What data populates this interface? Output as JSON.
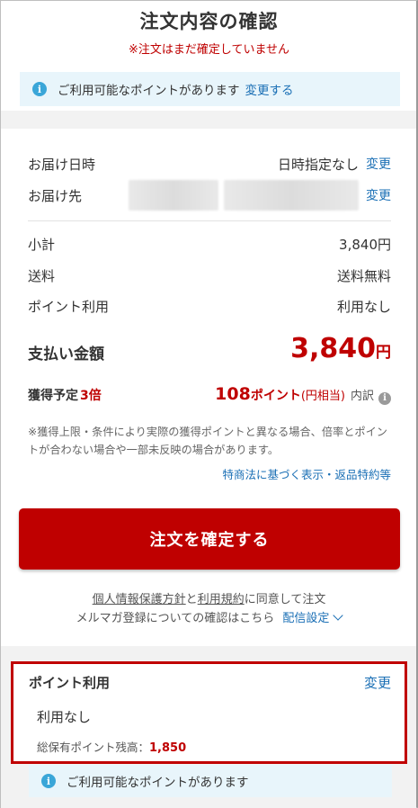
{
  "header": {
    "title": "注文内容の確認",
    "warning": "※注文はまだ確定していません"
  },
  "points_notice_top": {
    "text": "ご利用可能なポイントがあります",
    "link": "変更する",
    "icon": "info-icon"
  },
  "delivery": {
    "date_label": "お届け日時",
    "date_value": "日時指定なし",
    "date_change": "変更",
    "address_label": "お届け先",
    "address_change": "変更"
  },
  "summary": {
    "subtotal_label": "小計",
    "subtotal_value": "3,840円",
    "shipping_label": "送料",
    "shipping_value": "送料無料",
    "points_label": "ポイント利用",
    "points_value": "利用なし"
  },
  "total": {
    "label": "支払い金額",
    "amount": "3,840",
    "unit": "円"
  },
  "earned": {
    "label": "獲得予定",
    "multiplier": "3倍",
    "points": "108",
    "unit": "ポイント",
    "note": "(円相当)",
    "breakdown": "内訳",
    "help_icon": "info-circle-icon"
  },
  "disclaimer": "※獲得上限・条件により実際の獲得ポイントと異なる場合、倍率とポイントが合わない場合や一部未反映の場合があります。",
  "legal_link": "特商法に基づく表示・返品特約等",
  "confirm_button": "注文を確定する",
  "agreement": {
    "privacy": "個人情報保護方針",
    "and": "と",
    "terms": "利用規約",
    "suffix": "に同意して注文",
    "newsletter": "メルマガ登録についての確認はこちら",
    "delivery_settings": "配信設定"
  },
  "points_card": {
    "title": "ポイント利用",
    "change": "変更",
    "value": "利用なし",
    "balance_label": "総保有ポイント残高：",
    "balance_value": "1,850"
  },
  "points_notice_bottom": {
    "text": "ご利用可能なポイントがあります",
    "icon": "info-icon"
  },
  "colors": {
    "accent_red": "#bf0000",
    "link_blue": "#1a6fb5",
    "info_bg": "#e8f5fb",
    "highlight_border": "#c00000"
  }
}
